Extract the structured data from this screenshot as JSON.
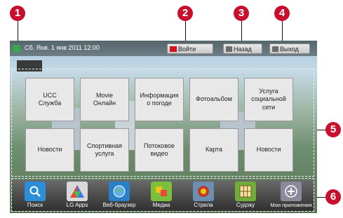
{
  "callouts": [
    "1",
    "2",
    "3",
    "4",
    "5",
    "6"
  ],
  "status": {
    "datetime": "Сб. Янв. 1 янв 2011  12:00"
  },
  "buttons": {
    "login": "Войти",
    "back": "Назад",
    "exit": "Выход"
  },
  "menu": {
    "tiles": [
      "UCC\nСлужба",
      "Movie\nОнлайн",
      "Информация\nо погоде",
      "Фотоальбом",
      "Услуга\nсоциальной\nсети",
      "Новости",
      "Спортивная\nуслуга",
      "Потоковое\nвидео",
      "Карта",
      "Новости"
    ]
  },
  "dock": {
    "apps": [
      {
        "label": "Поиск",
        "icon": "search-icon",
        "color": "#2a8fd6"
      },
      {
        "label": "LG Apps",
        "icon": "lg-apps-icon",
        "color": "#c9c9c9"
      },
      {
        "label": "Веб-браузер",
        "icon": "globe-icon",
        "color": "#2b7fc6"
      },
      {
        "label": "Медиа",
        "icon": "media-icon",
        "color": "#7bbf3a"
      },
      {
        "label": "Стрела",
        "icon": "game-icon",
        "color": "#c0392b"
      },
      {
        "label": "Судоку",
        "icon": "sudoku-icon",
        "color": "#6fae3a"
      },
      {
        "label": "Мои приложения",
        "icon": "plus-icon",
        "color": "#8a8a9a"
      }
    ]
  },
  "colors": {
    "callout": "#c8102e",
    "key_red": "#d1141d"
  }
}
